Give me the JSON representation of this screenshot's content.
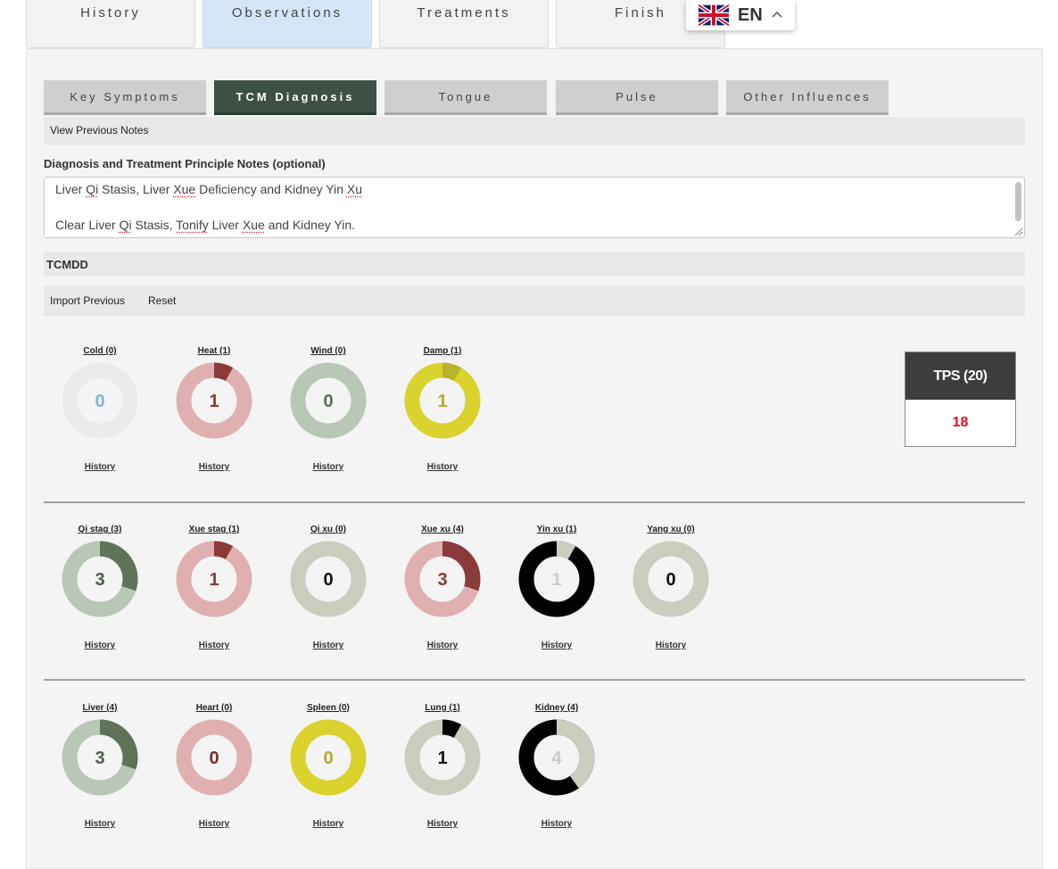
{
  "top_tabs": [
    {
      "label": "History"
    },
    {
      "label": "Observations",
      "active": true
    },
    {
      "label": "Treatments"
    },
    {
      "label": "Finish"
    }
  ],
  "language": {
    "code": "EN",
    "flag_icon": "uk-flag-icon",
    "chevron_icon": "chevron-up-icon"
  },
  "sub_tabs": [
    {
      "label": "Key Symptoms"
    },
    {
      "label": "TCM Diagnosis",
      "active": true
    },
    {
      "label": "Tongue"
    },
    {
      "label": "Pulse"
    },
    {
      "label": "Other Influences"
    }
  ],
  "view_previous_notes": "View Previous Notes",
  "notes": {
    "label": "Diagnosis and Treatment Principle Notes (optional)",
    "line1": "Liver Qi Stasis, Liver Xue Deficiency and Kidney Yin Xu",
    "line2": "Clear Liver Qi Stasis, Tonify Liver Xue and Kidney Yin."
  },
  "tcmdd": {
    "title": "TCMDD",
    "import_label": "Import Previous",
    "reset_label": "Reset"
  },
  "history_label": "History",
  "tps": {
    "label": "TPS (20)",
    "value": "18",
    "value_color": "#e0101a"
  },
  "rows": [
    [
      {
        "title": "Cold (0)",
        "value": "0",
        "fraction": 0,
        "ring_color": "#ebebeb",
        "segment_color": "#ebebeb",
        "text_color": "#7bb7dc"
      },
      {
        "title": "Heat (1)",
        "value": "1",
        "fraction": 0.083,
        "ring_color": "#e0b0b0",
        "segment_color": "#8b3a3a",
        "text_color": "#8b3a3a"
      },
      {
        "title": "Wind (0)",
        "value": "0",
        "fraction": 0,
        "ring_color": "#b9c7b7",
        "segment_color": "#b9c7b7",
        "text_color": "#5b6b58"
      },
      {
        "title": "Damp (1)",
        "value": "1",
        "fraction": 0.083,
        "ring_color": "#dad32e",
        "segment_color": "#b9b32a",
        "text_color": "#b3ab2a"
      }
    ],
    [
      {
        "title": "Qi stag (3)",
        "value": "3",
        "fraction": 0.3,
        "ring_color": "#b9c7b7",
        "segment_color": "#5f7359",
        "text_color": "#4c5e48"
      },
      {
        "title": "Xue stag (1)",
        "value": "1",
        "fraction": 0.083,
        "ring_color": "#e0b0b0",
        "segment_color": "#8b3a3a",
        "text_color": "#8b3a3a"
      },
      {
        "title": "Qi xu (0)",
        "value": "0",
        "fraction": 0,
        "ring_color": "#cdcdbf",
        "segment_color": "#cdcdbf",
        "text_color": "#111111"
      },
      {
        "title": "Xue xu (4)",
        "value": "3",
        "fraction": 0.3,
        "ring_color": "#e0b0b0",
        "segment_color": "#8b3a3a",
        "text_color": "#8b3a3a"
      },
      {
        "title": "Yin xu (1)",
        "value": "1",
        "fraction": 0.083,
        "ring_color": "#000000",
        "segment_color": "#cdcdbf",
        "text_color": "#cdcdbf"
      },
      {
        "title": "Yang xu (0)",
        "value": "0",
        "fraction": 0,
        "ring_color": "#cdcdbf",
        "segment_color": "#cdcdbf",
        "text_color": "#111111"
      }
    ],
    [
      {
        "title": "Liver (4)",
        "value": "3",
        "fraction": 0.3,
        "ring_color": "#b9c7b7",
        "segment_color": "#5f7359",
        "text_color": "#4c5e48"
      },
      {
        "title": "Heart (0)",
        "value": "0",
        "fraction": 0,
        "ring_color": "#e0b0b0",
        "segment_color": "#e0b0b0",
        "text_color": "#7a2e2e"
      },
      {
        "title": "Spleen (0)",
        "value": "0",
        "fraction": 0,
        "ring_color": "#dad32e",
        "segment_color": "#dad32e",
        "text_color": "#b3ab2a"
      },
      {
        "title": "Lung (1)",
        "value": "1",
        "fraction": 0.083,
        "ring_color": "#cdcdbf",
        "segment_color": "#000000",
        "text_color": "#111111"
      },
      {
        "title": "Kidney (4)",
        "value": "4",
        "fraction": 0.4,
        "ring_color": "#000000",
        "segment_color": "#cdcdbf",
        "text_color": "#cdcdbf"
      }
    ]
  ]
}
